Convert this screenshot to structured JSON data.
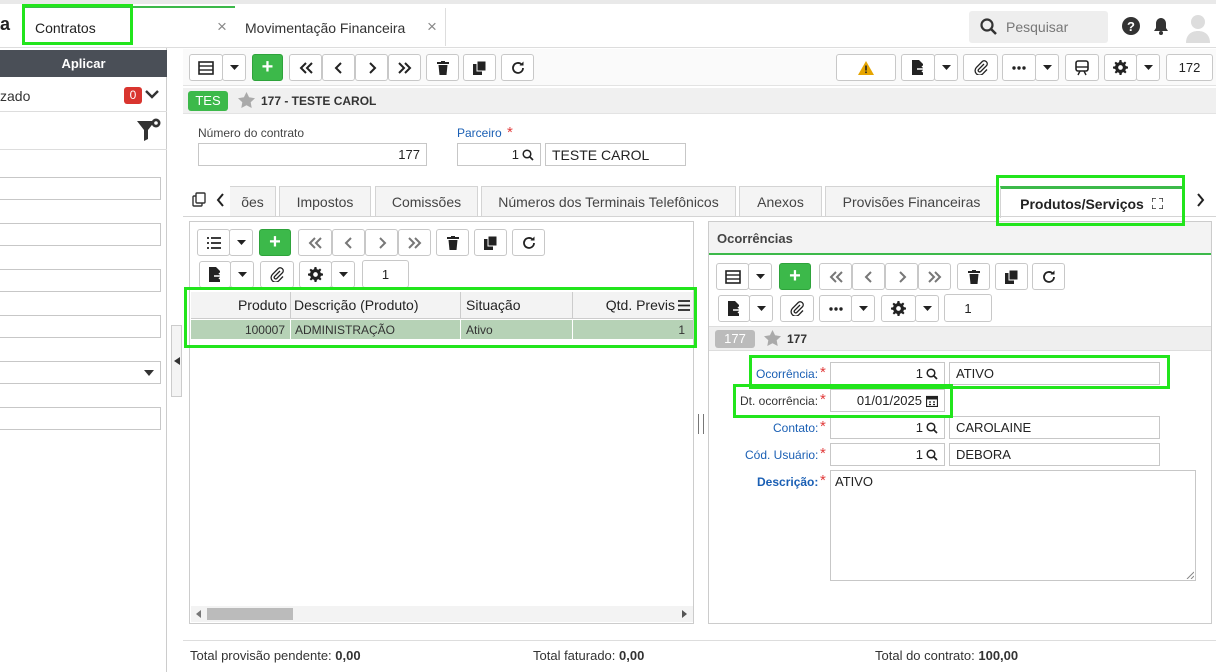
{
  "app": {
    "logo_fragment": "a"
  },
  "tabs": [
    {
      "label": "Contratos"
    },
    {
      "label": "Movimentação Financeira"
    }
  ],
  "tab_close": "×",
  "header": {
    "search_placeholder": "Pesquisar"
  },
  "left_panel": {
    "apply_label": "Aplicar",
    "filter_status": "zado",
    "filter_count": "0"
  },
  "toolbar": {
    "record_number": "172"
  },
  "record": {
    "badge": "TES",
    "title": "177 - TESTE CAROL"
  },
  "form": {
    "contract_number_label": "Número do contrato",
    "contract_number_value": "177",
    "partner_label": "Parceiro",
    "partner_code": "1",
    "partner_name": "TESTE CAROL",
    "required": "*"
  },
  "detail_tabs": [
    {
      "label": "ões"
    },
    {
      "label": "Impostos"
    },
    {
      "label": "Comissões"
    },
    {
      "label": "Números dos Terminais Telefônicos"
    },
    {
      "label": "Anexos"
    },
    {
      "label": "Provisões Financeiras"
    },
    {
      "label": "Produtos/Serviços"
    }
  ],
  "grid": {
    "page": "1",
    "columns": [
      "Produto",
      "Descrição (Produto)",
      "Situação",
      "Qtd. Previs"
    ],
    "rows": [
      {
        "produto": "100007",
        "descricao": "ADMINISTRAÇÃO",
        "situacao": "Ativo",
        "qtd": "1"
      }
    ]
  },
  "ocorrencias": {
    "title": "Ocorrências",
    "page": "1",
    "badge": "177",
    "record_title": "177",
    "ocorrencia_label": "Ocorrência:",
    "ocorrencia_code": "1",
    "ocorrencia_name": "ATIVO",
    "dt_label": "Dt. ocorrência:",
    "dt_value": "01/01/2025",
    "contato_label": "Contato:",
    "contato_code": "1",
    "contato_name": "CAROLAINE",
    "usuario_label": "Cód. Usuário:",
    "usuario_code": "1",
    "usuario_name": "DEBORA",
    "descricao_label": "Descrição:",
    "descricao_value": "ATIVO"
  },
  "footer": {
    "pendente_label": "Total provisão pendente:",
    "pendente_value": "0,00",
    "faturado_label": "Total faturado:",
    "faturado_value": "0,00",
    "contrato_label": "Total do contrato:",
    "contrato_value": "100,00"
  },
  "colors": {
    "accent_green": "#3cb94a",
    "highlight": "#22e51c",
    "link_blue": "#1a5fb4",
    "dark_bar": "#4a4f57"
  }
}
